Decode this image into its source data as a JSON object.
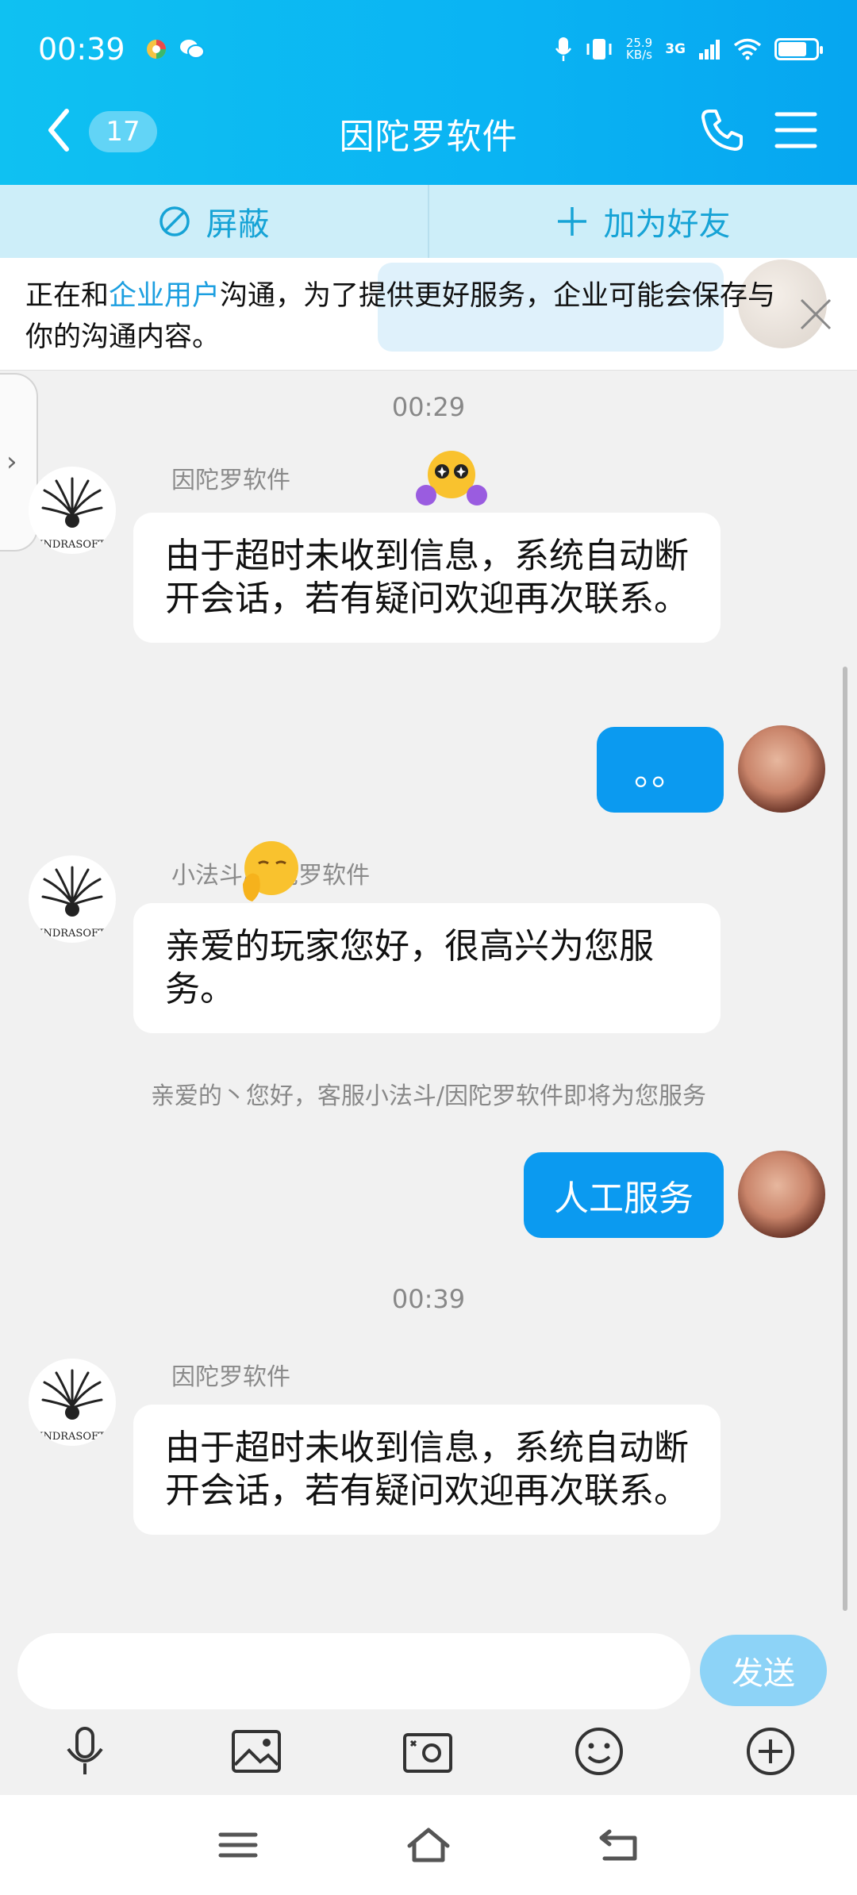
{
  "status": {
    "time": "00:39",
    "speed_value": "25.9",
    "speed_unit": "KB/s",
    "network": "3G"
  },
  "header": {
    "badge_count": "17",
    "title": "因陀罗软件"
  },
  "actions": {
    "block_label": "屏蔽",
    "add_friend_label": "加为好友"
  },
  "notice": {
    "text_before": "正在和",
    "highlight": "企业用户",
    "text_after": "沟通，为了提供更好服务，企业可能会保存与你的沟通内容。"
  },
  "messages": {
    "t1": "00:29",
    "m1_sender": "因陀罗软件",
    "m1_text": "由于超时未收到信息，系统自动断开会话，若有疑问欢迎再次联系。",
    "m2_text": "。。",
    "m3_sender": "小法斗/因陀罗软件",
    "m3_text": "亲爱的玩家您好，很高兴为您服务。",
    "system_note": "亲爱的丶您好，客服小法斗/因陀罗软件即将为您服务",
    "m4_text": "人工服务",
    "t2": "00:39",
    "m5_sender": "因陀罗软件",
    "m5_text": "由于超时未收到信息，系统自动断开会话，若有疑问欢迎再次联系。"
  },
  "input": {
    "placeholder": "",
    "send_label": "发送"
  },
  "icons": [
    "mic-icon",
    "image-icon",
    "camera-icon",
    "emoji-icon",
    "plus-icon"
  ],
  "colors": {
    "header": "#0ab3f3",
    "accent": "#0b9af0",
    "send_disabled": "#8dd3f7"
  }
}
